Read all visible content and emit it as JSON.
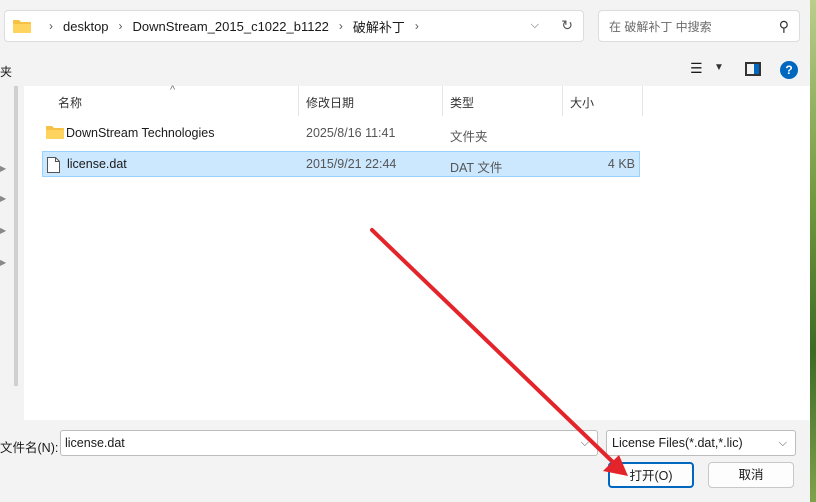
{
  "address": {
    "breadcrumbs": [
      "desktop",
      "DownStream_2015_c1022_b1122",
      "破解补丁"
    ],
    "folder_icon": "folder-icon"
  },
  "search": {
    "placeholder": "在 破解补丁 中搜索"
  },
  "toolbar": {
    "left_label": "夹"
  },
  "columns": {
    "name": "名称",
    "date": "修改日期",
    "type": "类型",
    "size": "大小"
  },
  "files": [
    {
      "name": "DownStream Technologies",
      "date": "2025/8/16 11:41",
      "type": "文件夹",
      "size": "",
      "icon": "folder-icon"
    },
    {
      "name": "license.dat",
      "date": "2015/9/21 22:44",
      "type": "DAT 文件",
      "size": "4 KB",
      "icon": "file-icon"
    }
  ],
  "bottom": {
    "filename_label": "文件名(N):",
    "filename_value": "license.dat",
    "filter_value": "License Files(*.dat,*.lic)",
    "open_label": "打开(O)",
    "cancel_label": "取消"
  },
  "colors": {
    "accent": "#0067c0",
    "selection": "#cce8ff",
    "arrow": "#e3242b"
  }
}
